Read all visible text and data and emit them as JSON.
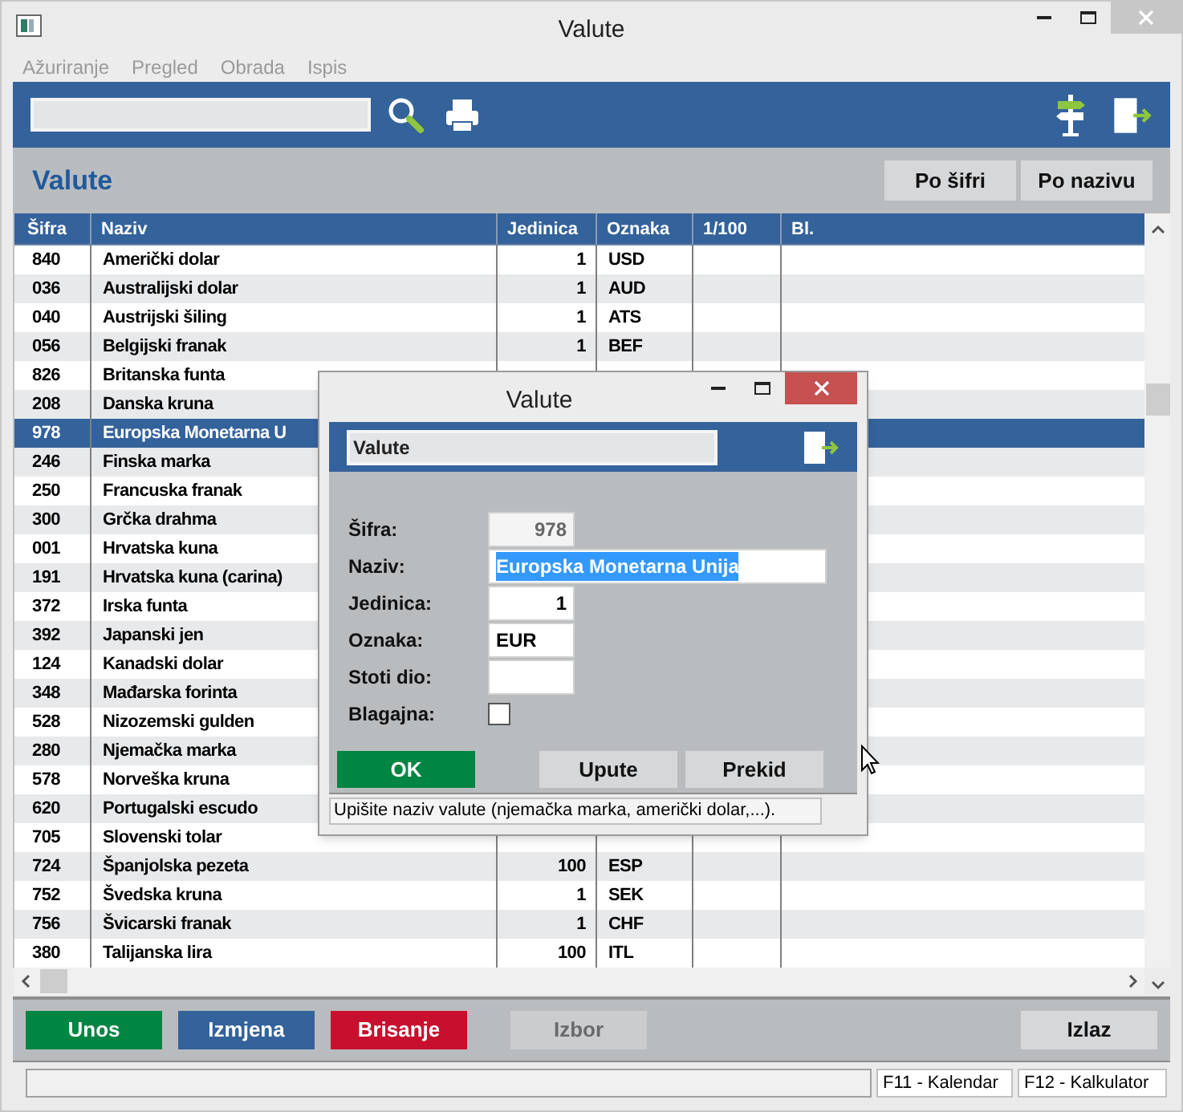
{
  "window": {
    "title": "Valute"
  },
  "menu": [
    {
      "label": "Ažuriranje",
      "disabled": true
    },
    {
      "label": "Pregled",
      "disabled": true
    },
    {
      "label": "Obrada",
      "disabled": true
    },
    {
      "label": "Ispis",
      "disabled": true
    }
  ],
  "header": {
    "title": "Valute",
    "sort_buttons": [
      "Po šifri",
      "Po nazivu"
    ]
  },
  "table": {
    "columns": [
      "Šifra",
      "Naziv",
      "Jedinica",
      "Oznaka",
      "1/100",
      "Bl."
    ],
    "rows": [
      {
        "sifra": "840",
        "naziv": "Američki dolar",
        "jedinica": "1",
        "oznaka": "USD",
        "selected": false
      },
      {
        "sifra": "036",
        "naziv": "Australijski dolar",
        "jedinica": "1",
        "oznaka": "AUD",
        "selected": false
      },
      {
        "sifra": "040",
        "naziv": "Austrijski šiling",
        "jedinica": "1",
        "oznaka": "ATS",
        "selected": false
      },
      {
        "sifra": "056",
        "naziv": "Belgijski franak",
        "jedinica": "1",
        "oznaka": "BEF",
        "selected": false
      },
      {
        "sifra": "826",
        "naziv": "Britanska funta",
        "selected": false
      },
      {
        "sifra": "208",
        "naziv": "Danska kruna",
        "selected": false
      },
      {
        "sifra": "978",
        "naziv": "Europska Monetarna U",
        "selected": true
      },
      {
        "sifra": "246",
        "naziv": "Finska marka",
        "selected": false
      },
      {
        "sifra": "250",
        "naziv": "Francuska franak",
        "selected": false
      },
      {
        "sifra": "300",
        "naziv": "Grčka drahma",
        "selected": false
      },
      {
        "sifra": "001",
        "naziv": "Hrvatska kuna",
        "selected": false
      },
      {
        "sifra": "191",
        "naziv": "Hrvatska kuna (carina)",
        "selected": false
      },
      {
        "sifra": "372",
        "naziv": "Irska funta",
        "selected": false
      },
      {
        "sifra": "392",
        "naziv": "Japanski jen",
        "selected": false
      },
      {
        "sifra": "124",
        "naziv": "Kanadski dolar",
        "selected": false
      },
      {
        "sifra": "348",
        "naziv": "Mađarska forinta",
        "selected": false
      },
      {
        "sifra": "528",
        "naziv": "Nizozemski gulden",
        "selected": false
      },
      {
        "sifra": "280",
        "naziv": "Njemačka marka",
        "selected": false
      },
      {
        "sifra": "578",
        "naziv": "Norveška kruna",
        "selected": false
      },
      {
        "sifra": "620",
        "naziv": "Portugalski escudo",
        "selected": false
      },
      {
        "sifra": "705",
        "naziv": "Slovenski tolar",
        "selected": false
      },
      {
        "sifra": "724",
        "naziv": "Španjolska pezeta",
        "jedinica": "100",
        "oznaka": "ESP",
        "selected": false
      },
      {
        "sifra": "752",
        "naziv": "Švedska kruna",
        "jedinica": "1",
        "oznaka": "SEK",
        "selected": false
      },
      {
        "sifra": "756",
        "naziv": "Švicarski franak",
        "jedinica": "1",
        "oznaka": "CHF",
        "selected": false
      },
      {
        "sifra": "380",
        "naziv": "Talijanska lira",
        "jedinica": "100",
        "oznaka": "ITL",
        "selected": false
      }
    ]
  },
  "buttons": [
    {
      "label": "Unos",
      "kind": "add",
      "disabled": false
    },
    {
      "label": "Izmjena",
      "kind": "edit",
      "disabled": false
    },
    {
      "label": "Brisanje",
      "kind": "delete",
      "disabled": false
    },
    {
      "label": "Izbor",
      "kind": "pick",
      "disabled": true
    },
    {
      "label": "Izlaz",
      "kind": "exit",
      "disabled": false
    }
  ],
  "status_bar": {
    "keys": [
      "F11 - Kalendar",
      "F12 - Kalkulator"
    ]
  },
  "dialog": {
    "title": "Valute",
    "heading": "Valute",
    "fields": [
      {
        "label": "Šifra:",
        "kind": "number",
        "value": "978",
        "disabled": true
      },
      {
        "label": "Naziv:",
        "kind": "long_text",
        "value": "Europska Monetarna Unija",
        "text_selected": true
      },
      {
        "label": "Jedinica:",
        "kind": "number",
        "value": "1"
      },
      {
        "label": "Oznaka:",
        "kind": "text",
        "value": "EUR"
      },
      {
        "label": "Stoti dio:",
        "kind": "text"
      },
      {
        "label": "Blagajna:",
        "kind": "checkbox",
        "checked": false
      }
    ],
    "buttons": [
      {
        "label": "OK",
        "kind": "ok"
      },
      {
        "label": "Upute",
        "kind": "plain"
      },
      {
        "label": "Prekid",
        "kind": "plain"
      }
    ],
    "hint": "Upišite naziv valute (njemačka marka, američki dolar,...)."
  }
}
